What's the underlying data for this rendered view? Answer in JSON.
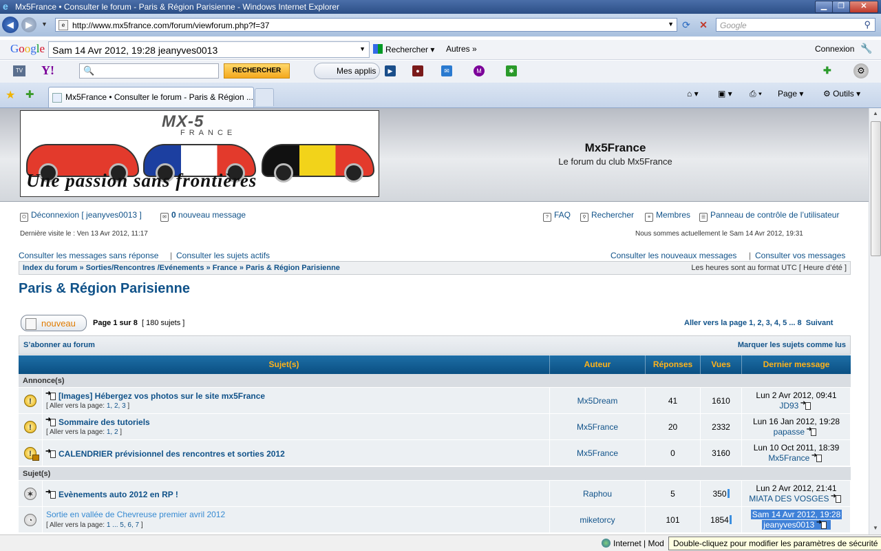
{
  "window": {
    "title": "Mx5France • Consulter le forum - Paris & Région Parisienne - Windows Internet Explorer"
  },
  "browser": {
    "address": "http://www.mx5france.com/forum/viewforum.php?f=37",
    "search_placeholder": "Google",
    "google_bar": {
      "logo": [
        "G",
        "o",
        "o",
        "g",
        "l",
        "e"
      ],
      "query": "Sam 14 Avr 2012, 19:28 jeanyves0013",
      "search_label": "Rechercher",
      "more_label": "Autres",
      "login_label": "Connexion"
    },
    "yahoo_bar": {
      "logo": "Y!",
      "search_button": "RECHERCHER",
      "apps_label": "Mes applis"
    },
    "tab_title": "Mx5France • Consulter le forum - Paris & Région ...",
    "commands": {
      "page": "Page",
      "tools": "Outils"
    },
    "status_zone": "Internet | Mod",
    "tooltip": "Double-cliquez pour modifier les paramètres de sécurité"
  },
  "site": {
    "logo_text": "MX-5",
    "logo_sub": "FRANCE",
    "logo_tagline": "Une passion sans frontières",
    "title": "Mx5France",
    "description": "Le forum du club Mx5France"
  },
  "userbar": {
    "logout": "Déconnexion [ jeanyves0013 ]",
    "new_count": "0",
    "new_messages": "nouveau message",
    "faq": "FAQ",
    "search": "Rechercher",
    "members": "Membres",
    "ucp": "Panneau de contrôle de l’utilisateur",
    "last_visit": "Dernière visite le : Ven 13 Avr 2012, 11:17",
    "current_time": "Nous sommes actuellement le Sam 14 Avr 2012, 19:31"
  },
  "quicklinks": {
    "unanswered": "Consulter les messages sans réponse",
    "active": "Consulter les sujets actifs",
    "new_posts": "Consulter les nouveaux messages",
    "your_posts": "Consulter vos messages",
    "separator": "|"
  },
  "breadcrumb": "Index du forum » Sorties/Rencontres /Evénements » France » Paris & Région Parisienne",
  "timezone": "Les heures sont au format UTC [ Heure d’été ]",
  "forum_title": "Paris & Région Parisienne",
  "toolbar": {
    "new_topic": "nouveau",
    "page_prefix": "Page",
    "page_current": "1",
    "page_of": "sur",
    "page_total": "8",
    "topic_count": "[ 180 sujets ]",
    "goto": "Aller vers la page",
    "pages": "1, 2, 3, 4, 5 ... 8",
    "next": "Suivant",
    "subscribe": "S’abonner au forum",
    "mark_read": "Marquer les sujets comme lus"
  },
  "table": {
    "headers": [
      "Sujet(s)",
      "Auteur",
      "Réponses",
      "Vues",
      "Dernier message"
    ],
    "section_announcements": "Annonce(s)",
    "section_topics": "Sujet(s)",
    "goto_prefix": "Aller vers la page:",
    "announcements": [
      {
        "title": "[Images] Hébergez vos photos sur le site mx5France",
        "pages": "1, 2, 3",
        "author": "Mx5Dream",
        "replies": "41",
        "views": "1610",
        "last_date": "Lun 2 Avr 2012, 09:41",
        "last_user": "JD93"
      },
      {
        "title": "Sommaire des tutoriels",
        "pages": "1, 2",
        "author": "Mx5France",
        "replies": "20",
        "views": "2332",
        "last_date": "Lun 16 Jan 2012, 19:28",
        "last_user": "papasse"
      },
      {
        "title": "CALENDRIER prévisionnel des rencontres et sorties 2012",
        "pages": "",
        "author": "Mx5France",
        "replies": "0",
        "views": "3160",
        "last_date": "Lun 10 Oct 2011, 18:39",
        "last_user": "Mx5France"
      }
    ],
    "topics": [
      {
        "title": "Evènements auto 2012 en RP !",
        "pages": "",
        "author": "Raphou",
        "replies": "5",
        "views": "350",
        "last_date": "Lun 2 Avr 2012, 21:41",
        "last_user": "MIATA DES VOSGES"
      },
      {
        "title": "Sortie en vallée de Chevreuse premier avril 2012",
        "pages": "1 ... 5, 6, 7",
        "author": "miketorcy",
        "replies": "101",
        "views": "1854",
        "last_date": "Sam 14 Avr 2012, 19:28",
        "last_user": "jeanyves0013"
      }
    ]
  }
}
